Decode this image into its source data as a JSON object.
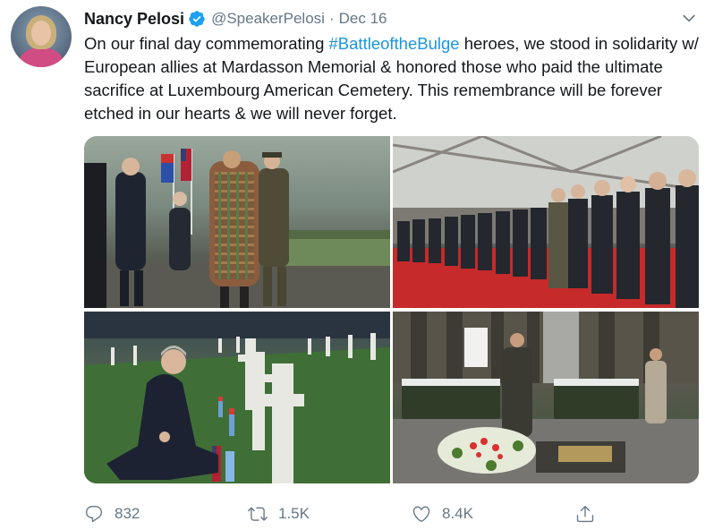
{
  "tweet": {
    "author_name": "Nancy Pelosi",
    "handle": "@SpeakerPelosi",
    "separator": "·",
    "date": "Dec 16",
    "text_before": "On our final day commemorating ",
    "hashtag": "#BattleoftheBulge",
    "text_after": " heroes, we stood in solidarity w/ European allies at Mardasson Memorial & honored those who paid the ultimate sacrifice at Luxembourg American Cemetery. This remembrance will be forever etched in our hearts & we will never forget."
  },
  "icons": {
    "verified": "verified-badge-icon",
    "more": "chevron-down-icon",
    "reply": "reply-icon",
    "retweet": "retweet-icon",
    "like": "heart-icon",
    "share": "share-icon"
  },
  "colors": {
    "link": "#1b95e0",
    "muted": "#657786",
    "verified": "#1da1f2",
    "text": "#14171a"
  },
  "actions": {
    "replies": "832",
    "retweets": "1.5K",
    "likes": "8.4K"
  }
}
